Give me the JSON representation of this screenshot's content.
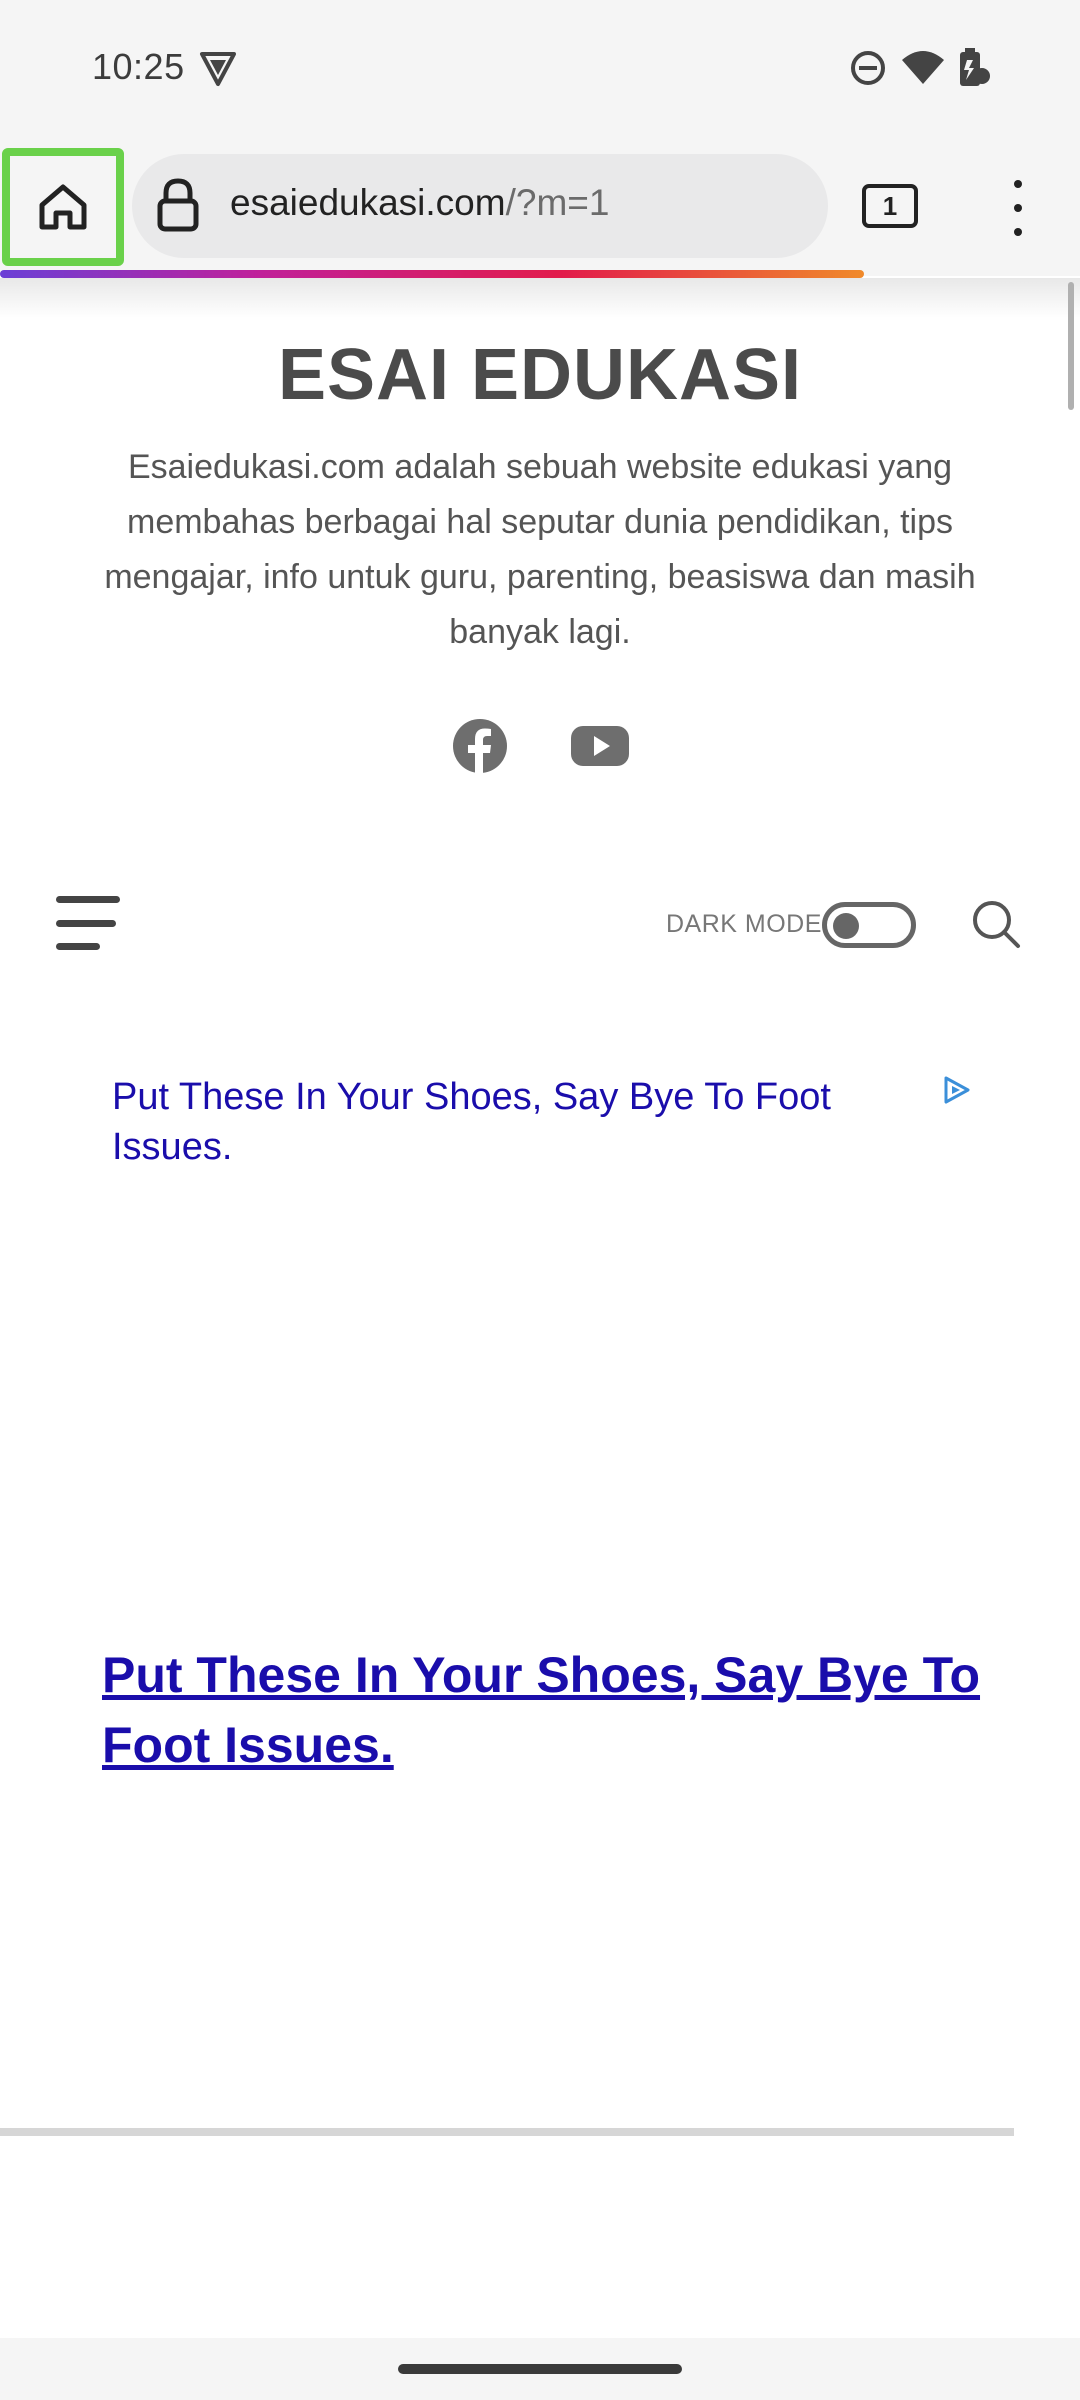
{
  "status_bar": {
    "time": "10:25",
    "left_icons": [
      "vpn-icon"
    ],
    "right_icons": [
      "do-not-disturb-icon",
      "wifi-icon",
      "battery-icon"
    ]
  },
  "browser": {
    "url_domain": "esaiedukasi.com",
    "url_path": "/?m=1",
    "tab_count": "1",
    "highlight_color": "#6ad14a",
    "progress_colors": [
      "#6b3fd6",
      "#c0209a",
      "#e21b4b",
      "#f08a2a"
    ]
  },
  "site": {
    "title": "ESAI EDUKASI",
    "description": "Esaiedukasi.com adalah sebuah website edukasi yang membahas berbagai hal seputar dunia pendidikan, tips mengajar, info untuk guru, parenting, beasiswa dan masih banyak lagi.",
    "social_icons": [
      "facebook-icon",
      "youtube-icon"
    ]
  },
  "nav": {
    "dark_mode_label": "DARK MODE",
    "dark_mode_on": false
  },
  "ad": {
    "headline": "Put These In Your Shoes, Say Bye To Foot Issues.",
    "link_text": "Put These In Your Shoes, Say Bye To Foot Issues.",
    "link_color": "#1a0dab"
  }
}
